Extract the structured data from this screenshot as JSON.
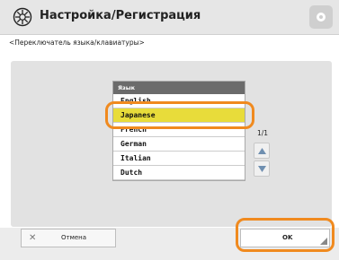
{
  "header": {
    "title": "Настройка/Регистрация",
    "subtitle": "<Переключатель языка/клавиатуры>"
  },
  "language_list": {
    "header": "Язык",
    "items": [
      "English",
      "Japanese",
      "French",
      "German",
      "Italian",
      "Dutch"
    ],
    "selected": "Japanese"
  },
  "pagination": {
    "indicator": "1/1"
  },
  "footer": {
    "cancel_label": "Отмена",
    "ok_label": "OK"
  },
  "icons": {
    "title": "settings-gear-icon",
    "corner": "menu-icon",
    "scroll_up": "arrow-up-icon",
    "scroll_down": "arrow-down-icon",
    "cancel": "close-icon"
  },
  "colors": {
    "selected_row": "#e8dc3a",
    "highlight_ring": "#f08a1f",
    "list_header": "#6b6b6b"
  }
}
